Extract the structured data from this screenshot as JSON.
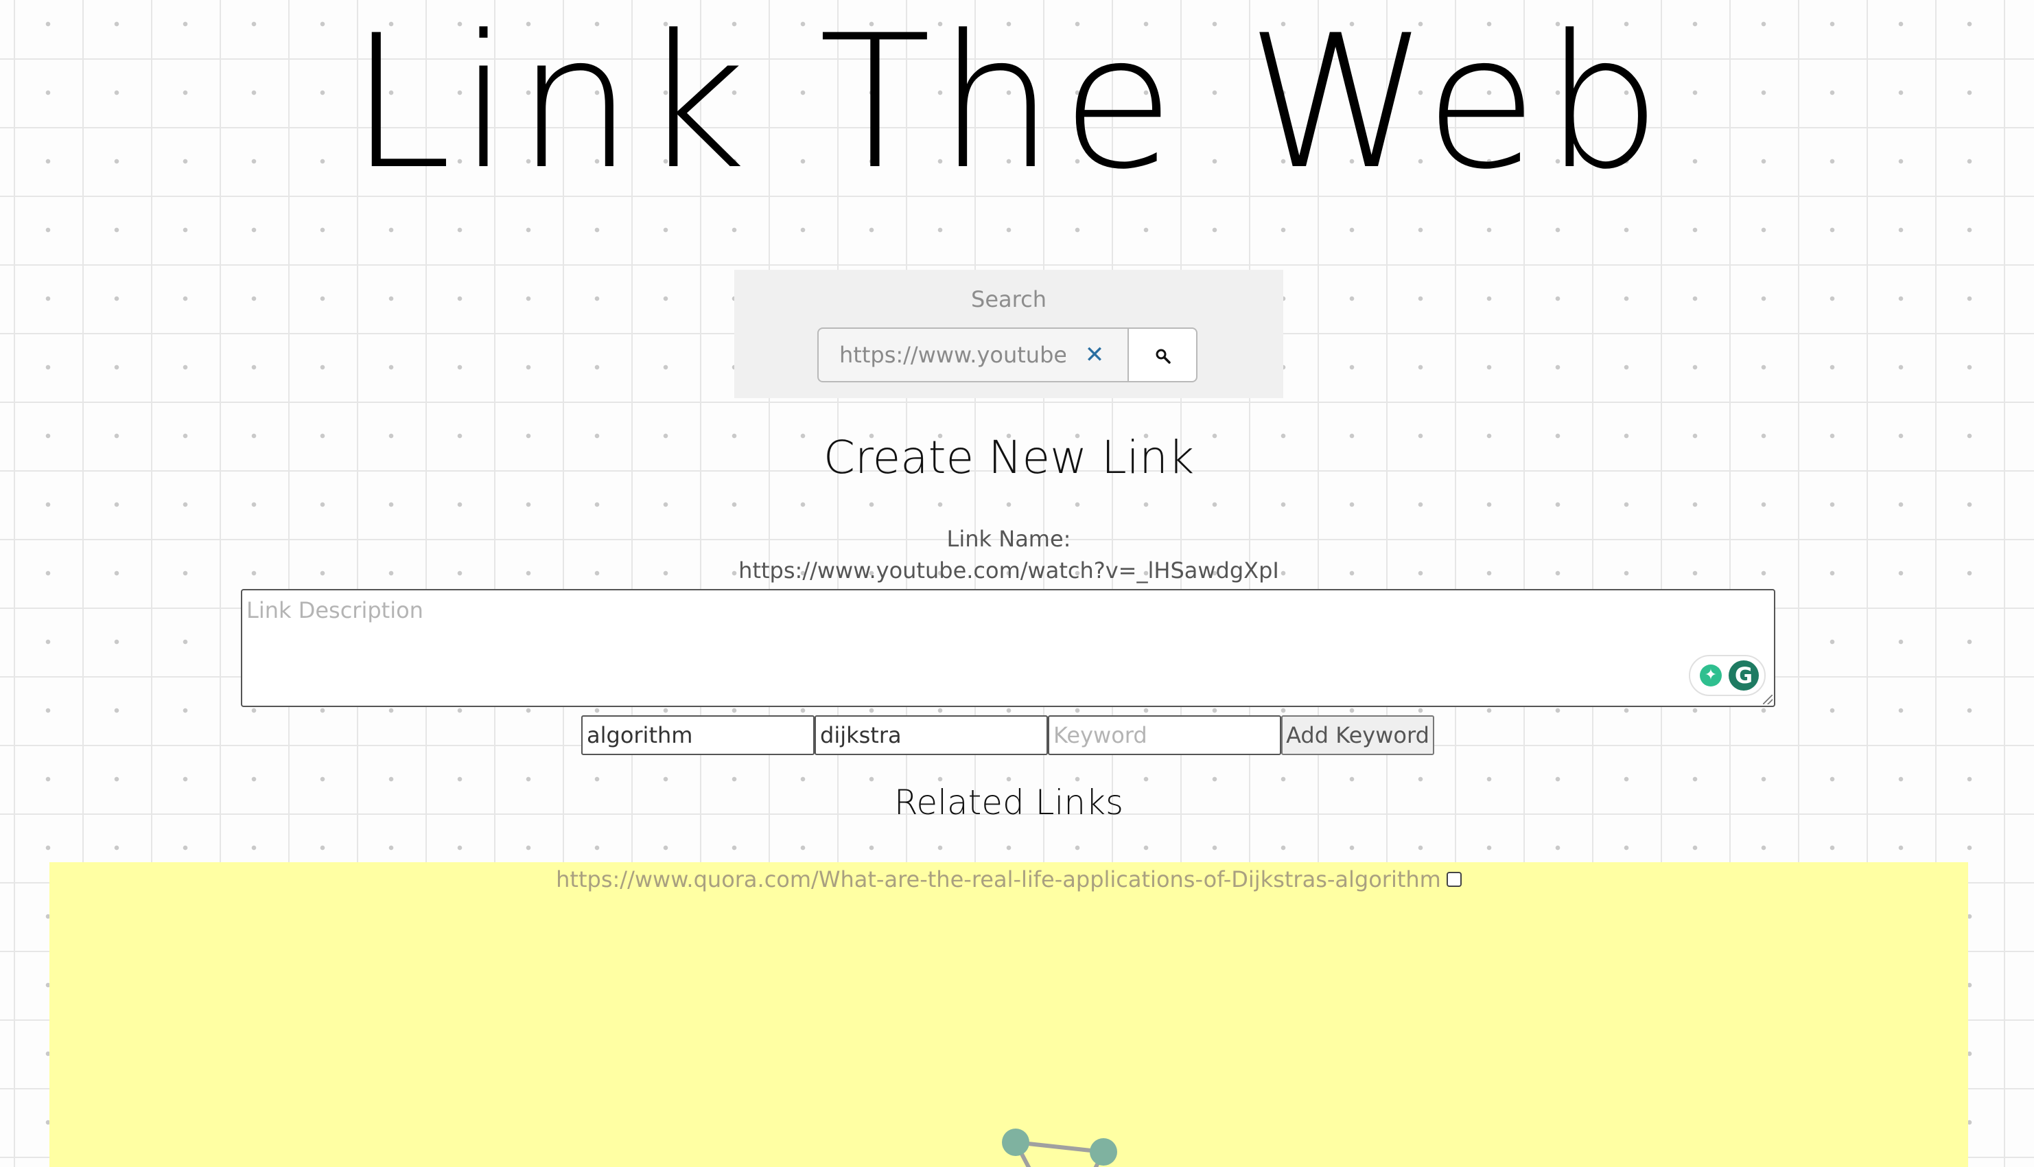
{
  "header": {
    "title": "Link The Web"
  },
  "search": {
    "label": "Search",
    "value": "https://www.youtube.com/watch?v=_lHSawdgXpI",
    "clear_icon": "close-icon",
    "button_icon": "search-icon"
  },
  "create": {
    "heading": "Create New Link",
    "link_name_label": "Link Name:",
    "link_name_value": "https://www.youtube.com/watch?v=_lHSawdgXpI",
    "description_placeholder": "Link Description",
    "keywords": [
      "algorithm",
      "dijkstra"
    ],
    "keyword_placeholder": "Keyword",
    "add_keyword_label": "Add Keyword"
  },
  "related": {
    "heading": "Related Links",
    "links": [
      {
        "url": "https://www.quora.com/What-are-the-real-life-applications-of-Dijkstras-algorithm",
        "checked": false
      }
    ],
    "background_color": "#ffffa3",
    "node_color": "#7fb2a0"
  },
  "extension": {
    "name": "Grammarly",
    "icons": [
      "bulb-icon",
      "grammarly-g-icon"
    ]
  }
}
